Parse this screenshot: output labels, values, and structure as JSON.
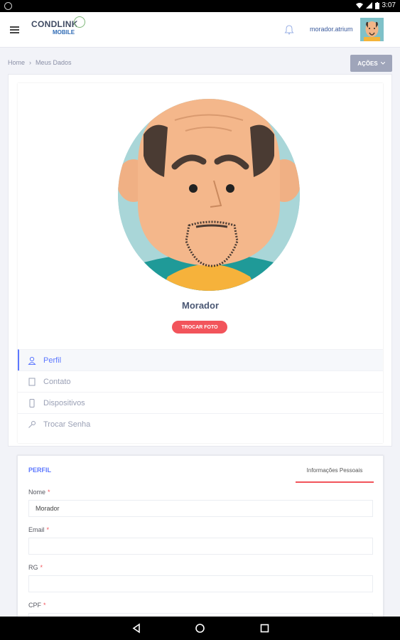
{
  "statusbar": {
    "time": "3:07"
  },
  "header": {
    "logo_main": "CONDLINK",
    "logo_sub": "MOBILE",
    "username": "morador.atrium"
  },
  "breadcrumb": {
    "home": "Home",
    "separator": "›",
    "current": "Meus Dados"
  },
  "actions": {
    "label": "AÇÕES"
  },
  "profile": {
    "name": "Morador",
    "change_photo": "TROCAR FOTO"
  },
  "menu": {
    "items": [
      {
        "label": "Perfil",
        "icon": "user-icon",
        "active": true
      },
      {
        "label": "Contato",
        "icon": "contact-icon",
        "active": false
      },
      {
        "label": "Dispositivos",
        "icon": "device-icon",
        "active": false
      },
      {
        "label": "Trocar Senha",
        "icon": "key-icon",
        "active": false
      }
    ]
  },
  "form": {
    "title": "PERFIL",
    "tab": "Informações Pessoais",
    "required_mark": "*",
    "fields": [
      {
        "label": "Nome",
        "value": "Morador"
      },
      {
        "label": "Email",
        "value": ""
      },
      {
        "label": "RG",
        "value": ""
      },
      {
        "label": "CPF",
        "value": ""
      }
    ]
  },
  "colors": {
    "accent": "#5d78ff",
    "danger": "#f2545b",
    "button_gray": "#9fa5ba"
  }
}
